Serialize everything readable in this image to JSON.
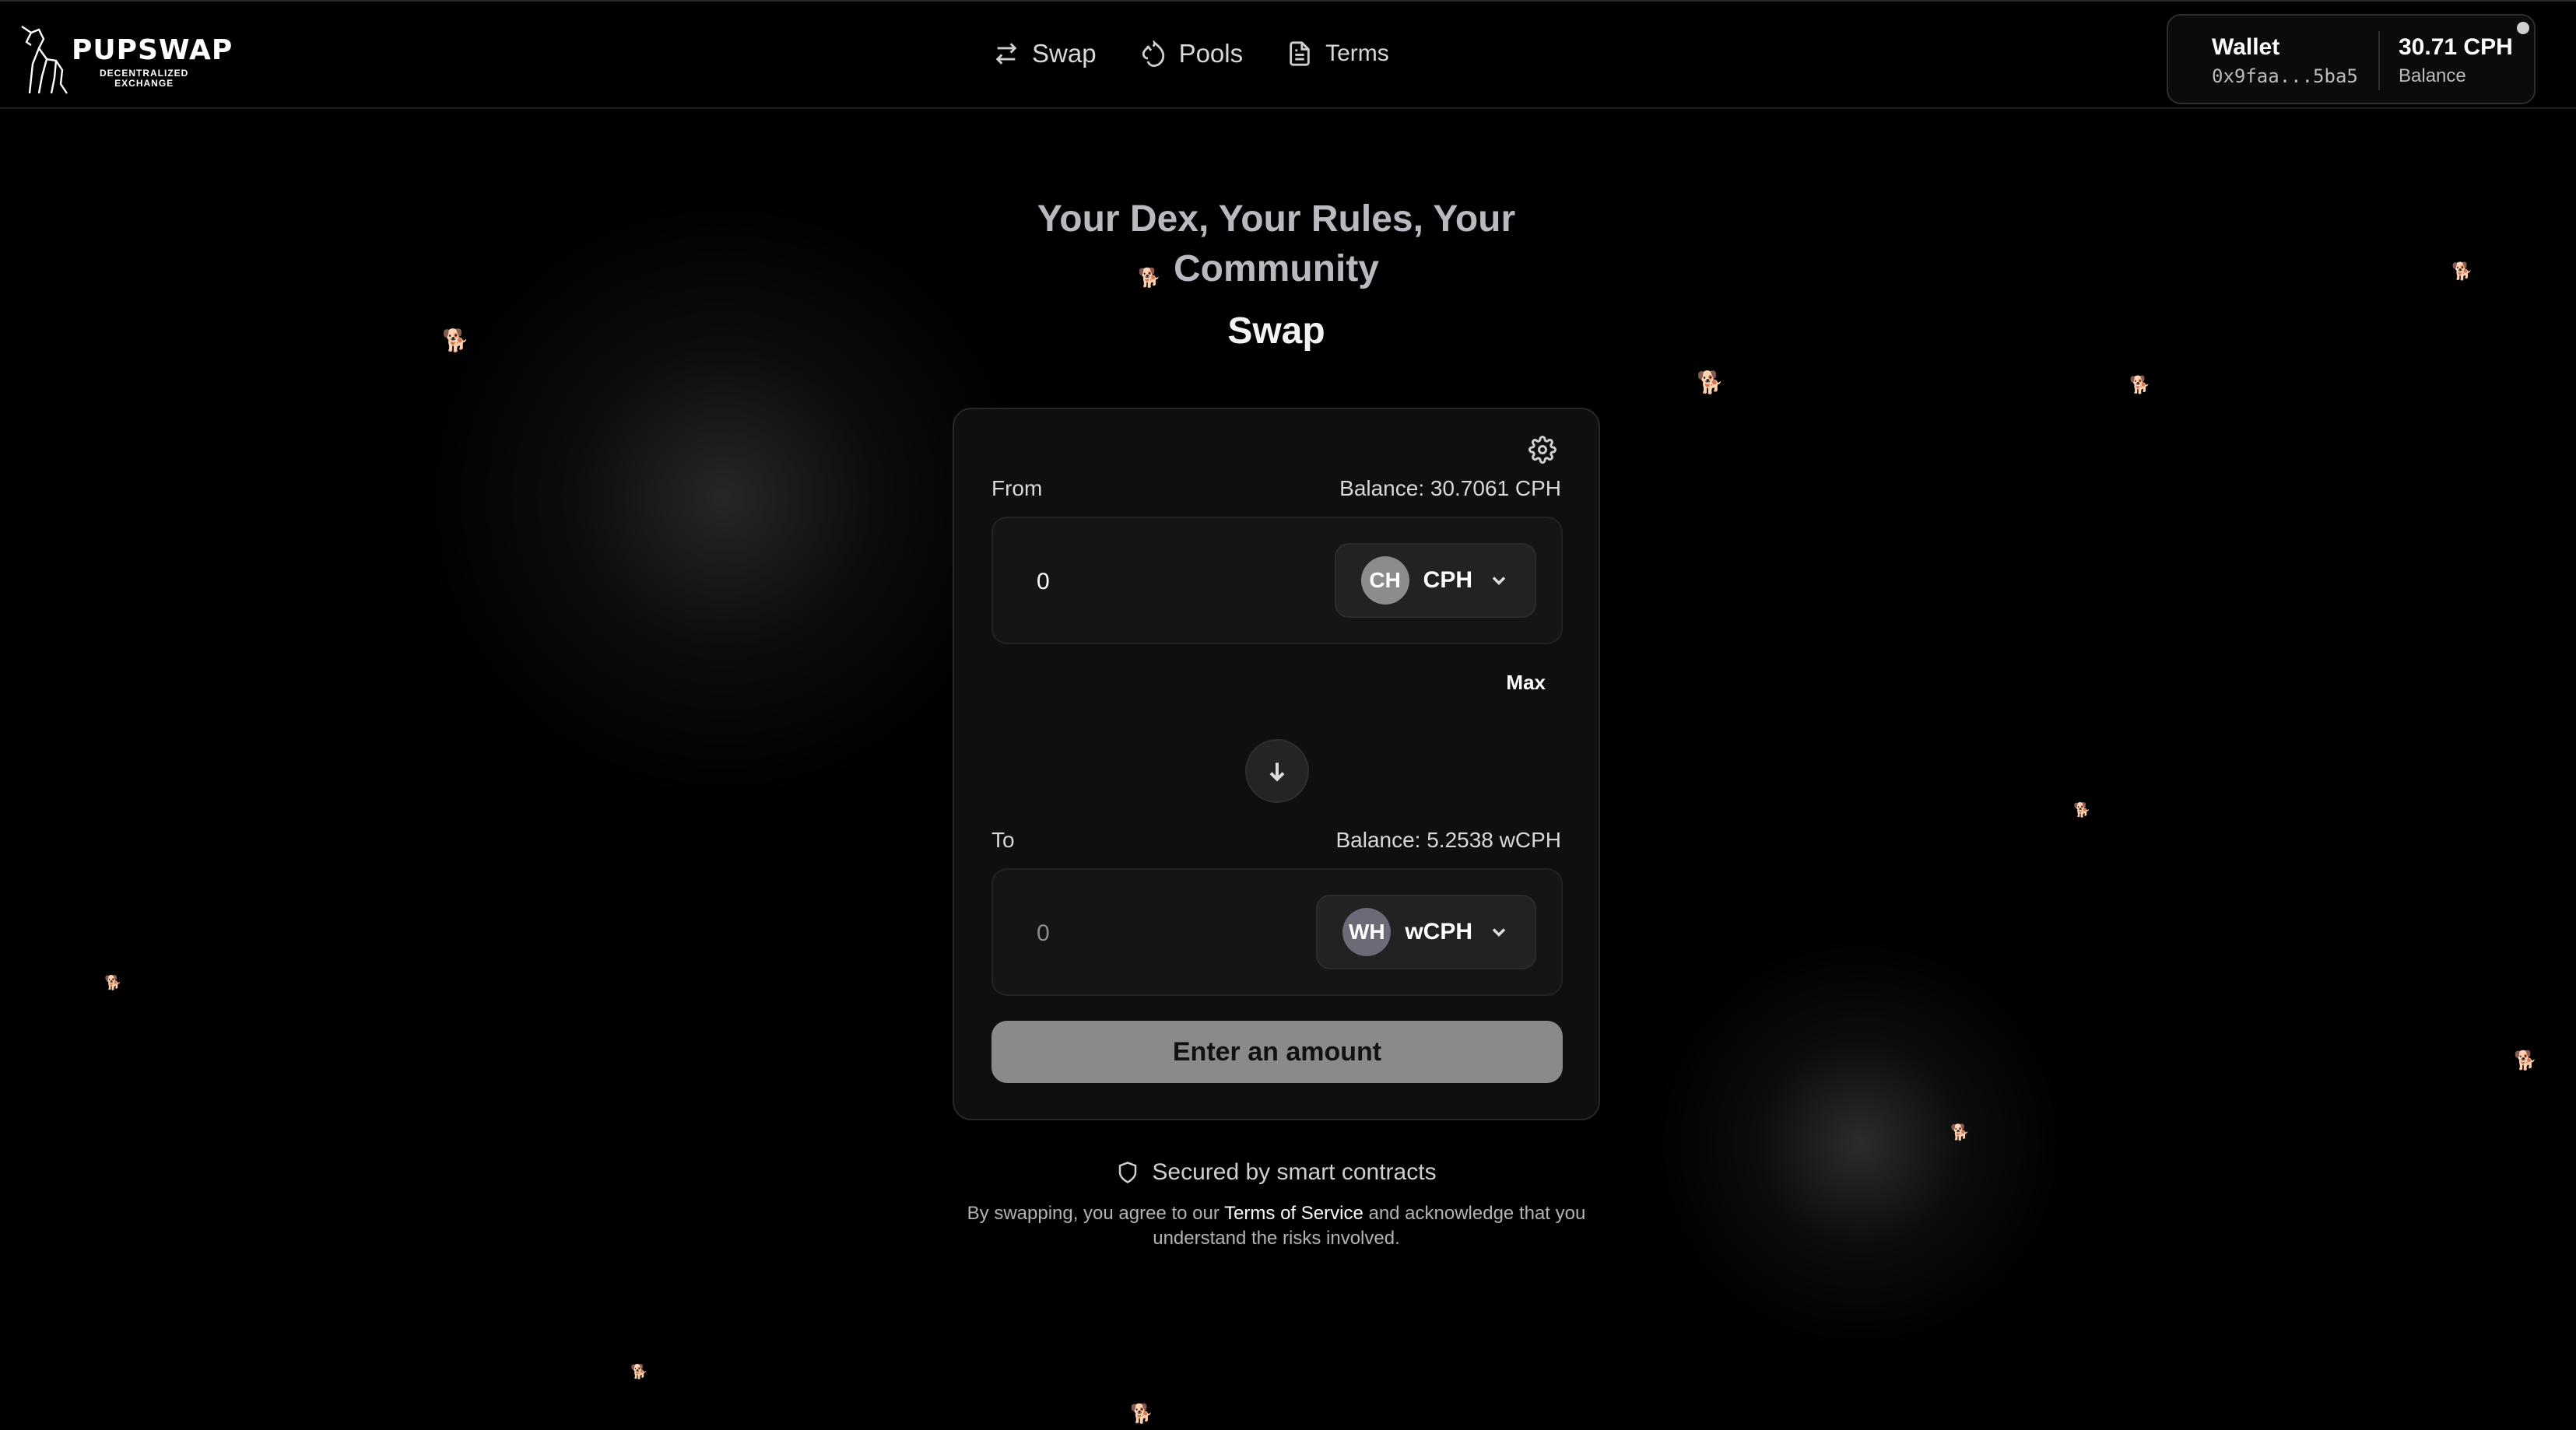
{
  "brand": {
    "name": "PUPSWAP",
    "subtitle_line1": "DECENTRALIZED",
    "subtitle_line2": "EXCHANGE"
  },
  "nav": {
    "items": [
      {
        "label": "Swap",
        "icon": "swap-arrows-icon"
      },
      {
        "label": "Pools",
        "icon": "droplet-icon"
      },
      {
        "label": "Terms",
        "icon": "document-icon"
      }
    ]
  },
  "wallet": {
    "label": "Wallet",
    "address": "0x9faa...5ba5",
    "balance": "30.71 CPH",
    "balance_label": "Balance"
  },
  "hero": {
    "tagline": "Your Dex, Your Rules, Your Community",
    "title": "Swap"
  },
  "swap": {
    "from": {
      "label": "From",
      "balance": "Balance: 30.7061 CPH",
      "amount": "0",
      "token_symbol": "CPH",
      "token_initials": "CH",
      "token_color": "#8c8c8c"
    },
    "max_label": "Max",
    "to": {
      "label": "To",
      "balance": "Balance: 5.2538 wCPH",
      "amount": "0",
      "token_symbol": "wCPH",
      "token_initials": "WH",
      "token_color": "#6b6b78"
    },
    "submit_label": "Enter an amount"
  },
  "footer": {
    "secured_text": "Secured by smart contracts",
    "disclaimer_prefix": "By swapping, you agree to our ",
    "disclaimer_link": "Terms of Service",
    "disclaimer_suffix": " and acknowledge that you understand the risks involved."
  },
  "colors": {
    "background": "#000000",
    "card": "#0f0f0f",
    "button_disabled": "#8a8a8a"
  }
}
